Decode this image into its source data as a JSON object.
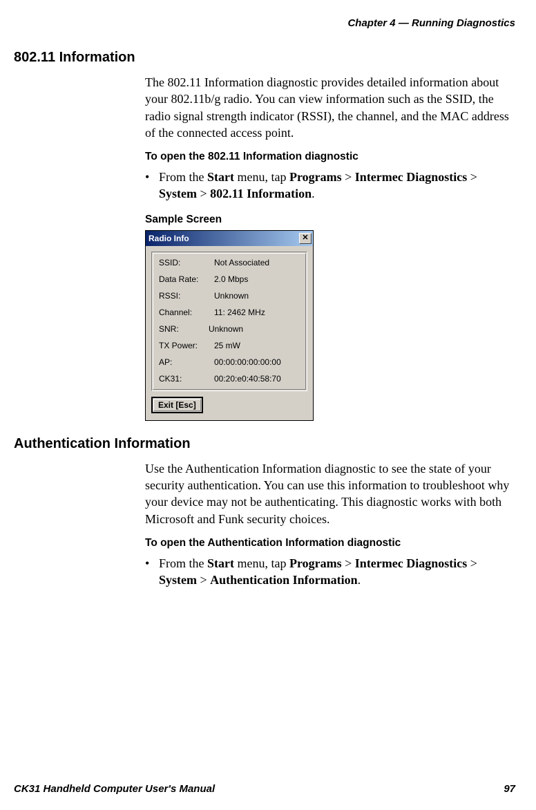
{
  "header": {
    "chapter": "Chapter 4 — Running Diagnostics"
  },
  "section1": {
    "title": "802.11 Information",
    "para": "The 802.11 Information diagnostic provides detailed information about your 802.11b/g radio. You can view information such as the SSID, the radio signal strength indicator (RSSI), the channel, and the MAC address of the connected access point.",
    "howto_heading": "To open the 802.11 Information diagnostic",
    "step": {
      "pre": "From the ",
      "b1": "Start",
      "t1": " menu, tap ",
      "b2": "Programs",
      "t2": " > ",
      "b3": "Intermec Diagnostics",
      "t3": " > ",
      "b4": "System",
      "t4": " > ",
      "b5": "802.11 Information",
      "post": "."
    },
    "sample_heading": "Sample Screen"
  },
  "radio_window": {
    "title": "Radio Info",
    "rows": [
      {
        "label": "SSID:",
        "value": "Not Associated"
      },
      {
        "label": "Data Rate:",
        "value": "2.0 Mbps"
      },
      {
        "label": "RSSI:",
        "value": "Unknown"
      },
      {
        "label": "Channel:",
        "value": "11: 2462 MHz"
      },
      {
        "label": "SNR:",
        "value": "Unknown"
      },
      {
        "label": "TX Power:",
        "value": "25 mW"
      },
      {
        "label": "AP:",
        "value": "00:00:00:00:00:00"
      },
      {
        "label": "CK31:",
        "value": "00:20:e0:40:58:70"
      }
    ],
    "exit_label": "Exit [Esc]"
  },
  "section2": {
    "title": "Authentication Information",
    "para": "Use the Authentication Information diagnostic to see the state of your security authentication. You can use this information to troubleshoot why your device may not be authenticating. This diagnostic works with both Microsoft and Funk security choices.",
    "howto_heading": "To open the Authentication Information diagnostic",
    "step": {
      "pre": "From the ",
      "b1": "Start",
      "t1": " menu, tap ",
      "b2": "Programs",
      "t2": " > ",
      "b3": "Intermec Diagnostics",
      "t3": " > ",
      "b4": "System",
      "t4": " > ",
      "b5": "Authentication Information",
      "post": "."
    }
  },
  "footer": {
    "left": "CK31 Handheld Computer User's Manual",
    "right": "97"
  }
}
